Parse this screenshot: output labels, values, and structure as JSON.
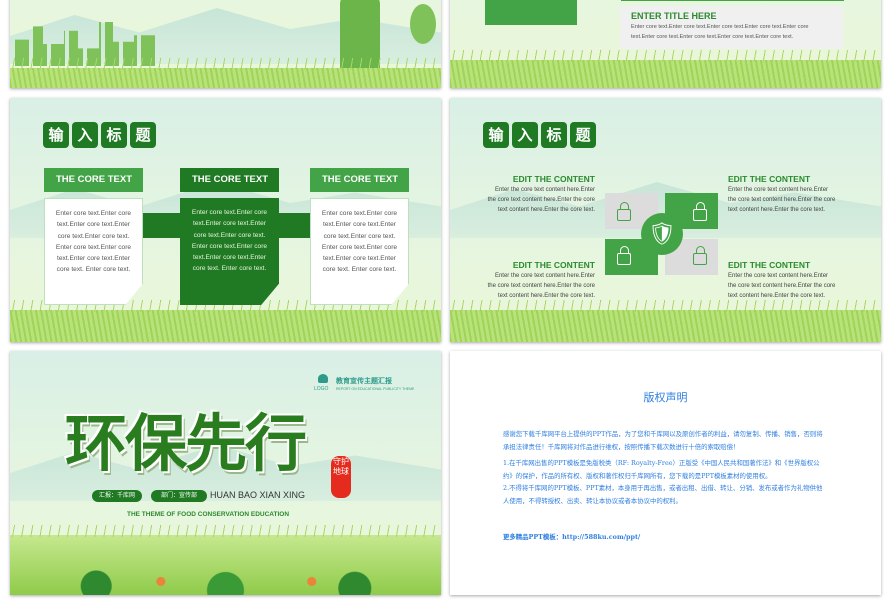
{
  "colors": {
    "dark_green": "#1f7a23",
    "green": "#43a447",
    "light_gray": "#dcdcdc",
    "copyright_blue": "#2f7fe0"
  },
  "slide2": {
    "title": "ENTER TITLE HERE",
    "body": "Enter core text.Enter core text.Enter core text.Enter core text.Enter core text.Enter core text.Enter core text.Enter core text.Enter core text."
  },
  "slide3": {
    "title_chars": [
      "输",
      "入",
      "标",
      "题"
    ],
    "columns": [
      {
        "header": "THE CORE TEXT",
        "body": "Enter core text.Enter core text.Enter core text.Enter core text.Enter core text. Enter core text.Enter core text.Enter core text.Enter core text. Enter core text."
      },
      {
        "header": "THE CORE TEXT",
        "body": "Enter core text.Enter core text.Enter core text.Enter core text.Enter core text. Enter core text.Enter core text.Enter core text.Enter core text. Enter core text."
      },
      {
        "header": "THE CORE TEXT",
        "body": "Enter core text.Enter core text.Enter core text.Enter core text.Enter core text. Enter core text.Enter core text.Enter core text.Enter core text. Enter core text."
      }
    ]
  },
  "slide4": {
    "title_chars": [
      "输",
      "入",
      "标",
      "题"
    ],
    "items": [
      {
        "title": "EDIT THE CONTENT",
        "body": "Enter the core text content here.Enter the core text content here.Enter the core text content here.Enter the core text."
      },
      {
        "title": "EDIT THE CONTENT",
        "body": "Enter the core text content here.Enter the core text content here.Enter the core text content here.Enter the core text."
      },
      {
        "title": "EDIT THE CONTENT",
        "body": "Enter the core text content here.Enter the core text content here.Enter the core text content here.Enter the core text."
      },
      {
        "title": "EDIT THE CONTENT",
        "body": "Enter the core text content here.Enter the core text content here.Enter the core text content here.Enter the core text."
      }
    ]
  },
  "slide5": {
    "logo": "LOGO",
    "header_cn": "教育宣传主题汇报",
    "header_en": "REPORT ON EDUCATIONAL PUBLICITY THEME",
    "main_title": "环保先行",
    "seal": "守护地球",
    "reporter": "汇报：千库网",
    "dept": "部门：宣传部",
    "pinyin": "HUAN BAO XIAN XING",
    "subtitle": "THE THEME OF FOOD CONSERVATION EDUCATION"
  },
  "slide6": {
    "title": "版权声明",
    "p1": "感谢您下载千库网平台上提供的PPT作品，为了您和千库网以及原创作者的利益，请勿复制、传播、销售，否则将承担法律责任！千库网将对作品进行维权，按照传播下载次数进行十倍的索取赔偿！",
    "p2": "1.在千库网出售的PPT模板是免版税类（RF: Royalty-Free）正版受《中国人民共和国著作法》和《世界版权公约》的保护，作品的所有权、版权和著作权归千库网所有，您下载的是PPT模板素材的使用权。",
    "p3": "2.不得将千库网的PPT模板、PPT素材，本身用于再出售，或者出租、出借、转让、分销、发布或者作为礼物供他人使用，不得转授权、出卖、转让本协议或者本协议中的权利。",
    "link": "更多精品PPT模板：http://588ku.com/ppt/"
  }
}
